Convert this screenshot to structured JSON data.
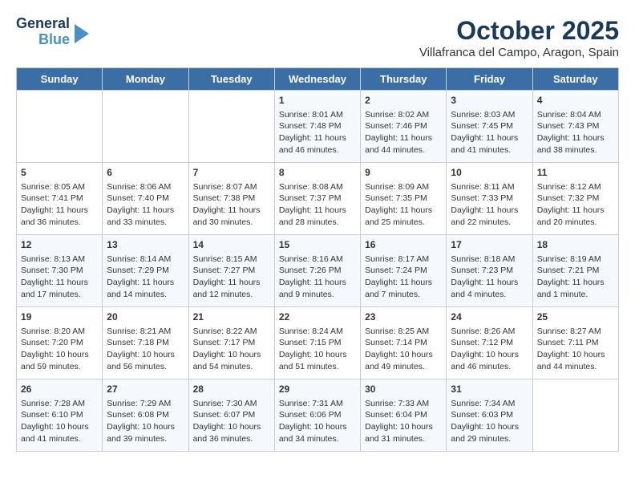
{
  "logo": {
    "line1": "General",
    "line2": "Blue"
  },
  "title": "October 2025",
  "location": "Villafranca del Campo, Aragon, Spain",
  "days_of_week": [
    "Sunday",
    "Monday",
    "Tuesday",
    "Wednesday",
    "Thursday",
    "Friday",
    "Saturday"
  ],
  "weeks": [
    [
      {
        "day": "",
        "content": ""
      },
      {
        "day": "",
        "content": ""
      },
      {
        "day": "",
        "content": ""
      },
      {
        "day": "1",
        "content": "Sunrise: 8:01 AM\nSunset: 7:48 PM\nDaylight: 11 hours and 46 minutes."
      },
      {
        "day": "2",
        "content": "Sunrise: 8:02 AM\nSunset: 7:46 PM\nDaylight: 11 hours and 44 minutes."
      },
      {
        "day": "3",
        "content": "Sunrise: 8:03 AM\nSunset: 7:45 PM\nDaylight: 11 hours and 41 minutes."
      },
      {
        "day": "4",
        "content": "Sunrise: 8:04 AM\nSunset: 7:43 PM\nDaylight: 11 hours and 38 minutes."
      }
    ],
    [
      {
        "day": "5",
        "content": "Sunrise: 8:05 AM\nSunset: 7:41 PM\nDaylight: 11 hours and 36 minutes."
      },
      {
        "day": "6",
        "content": "Sunrise: 8:06 AM\nSunset: 7:40 PM\nDaylight: 11 hours and 33 minutes."
      },
      {
        "day": "7",
        "content": "Sunrise: 8:07 AM\nSunset: 7:38 PM\nDaylight: 11 hours and 30 minutes."
      },
      {
        "day": "8",
        "content": "Sunrise: 8:08 AM\nSunset: 7:37 PM\nDaylight: 11 hours and 28 minutes."
      },
      {
        "day": "9",
        "content": "Sunrise: 8:09 AM\nSunset: 7:35 PM\nDaylight: 11 hours and 25 minutes."
      },
      {
        "day": "10",
        "content": "Sunrise: 8:11 AM\nSunset: 7:33 PM\nDaylight: 11 hours and 22 minutes."
      },
      {
        "day": "11",
        "content": "Sunrise: 8:12 AM\nSunset: 7:32 PM\nDaylight: 11 hours and 20 minutes."
      }
    ],
    [
      {
        "day": "12",
        "content": "Sunrise: 8:13 AM\nSunset: 7:30 PM\nDaylight: 11 hours and 17 minutes."
      },
      {
        "day": "13",
        "content": "Sunrise: 8:14 AM\nSunset: 7:29 PM\nDaylight: 11 hours and 14 minutes."
      },
      {
        "day": "14",
        "content": "Sunrise: 8:15 AM\nSunset: 7:27 PM\nDaylight: 11 hours and 12 minutes."
      },
      {
        "day": "15",
        "content": "Sunrise: 8:16 AM\nSunset: 7:26 PM\nDaylight: 11 hours and 9 minutes."
      },
      {
        "day": "16",
        "content": "Sunrise: 8:17 AM\nSunset: 7:24 PM\nDaylight: 11 hours and 7 minutes."
      },
      {
        "day": "17",
        "content": "Sunrise: 8:18 AM\nSunset: 7:23 PM\nDaylight: 11 hours and 4 minutes."
      },
      {
        "day": "18",
        "content": "Sunrise: 8:19 AM\nSunset: 7:21 PM\nDaylight: 11 hours and 1 minute."
      }
    ],
    [
      {
        "day": "19",
        "content": "Sunrise: 8:20 AM\nSunset: 7:20 PM\nDaylight: 10 hours and 59 minutes."
      },
      {
        "day": "20",
        "content": "Sunrise: 8:21 AM\nSunset: 7:18 PM\nDaylight: 10 hours and 56 minutes."
      },
      {
        "day": "21",
        "content": "Sunrise: 8:22 AM\nSunset: 7:17 PM\nDaylight: 10 hours and 54 minutes."
      },
      {
        "day": "22",
        "content": "Sunrise: 8:24 AM\nSunset: 7:15 PM\nDaylight: 10 hours and 51 minutes."
      },
      {
        "day": "23",
        "content": "Sunrise: 8:25 AM\nSunset: 7:14 PM\nDaylight: 10 hours and 49 minutes."
      },
      {
        "day": "24",
        "content": "Sunrise: 8:26 AM\nSunset: 7:12 PM\nDaylight: 10 hours and 46 minutes."
      },
      {
        "day": "25",
        "content": "Sunrise: 8:27 AM\nSunset: 7:11 PM\nDaylight: 10 hours and 44 minutes."
      }
    ],
    [
      {
        "day": "26",
        "content": "Sunrise: 7:28 AM\nSunset: 6:10 PM\nDaylight: 10 hours and 41 minutes."
      },
      {
        "day": "27",
        "content": "Sunrise: 7:29 AM\nSunset: 6:08 PM\nDaylight: 10 hours and 39 minutes."
      },
      {
        "day": "28",
        "content": "Sunrise: 7:30 AM\nSunset: 6:07 PM\nDaylight: 10 hours and 36 minutes."
      },
      {
        "day": "29",
        "content": "Sunrise: 7:31 AM\nSunset: 6:06 PM\nDaylight: 10 hours and 34 minutes."
      },
      {
        "day": "30",
        "content": "Sunrise: 7:33 AM\nSunset: 6:04 PM\nDaylight: 10 hours and 31 minutes."
      },
      {
        "day": "31",
        "content": "Sunrise: 7:34 AM\nSunset: 6:03 PM\nDaylight: 10 hours and 29 minutes."
      },
      {
        "day": "",
        "content": ""
      }
    ]
  ]
}
